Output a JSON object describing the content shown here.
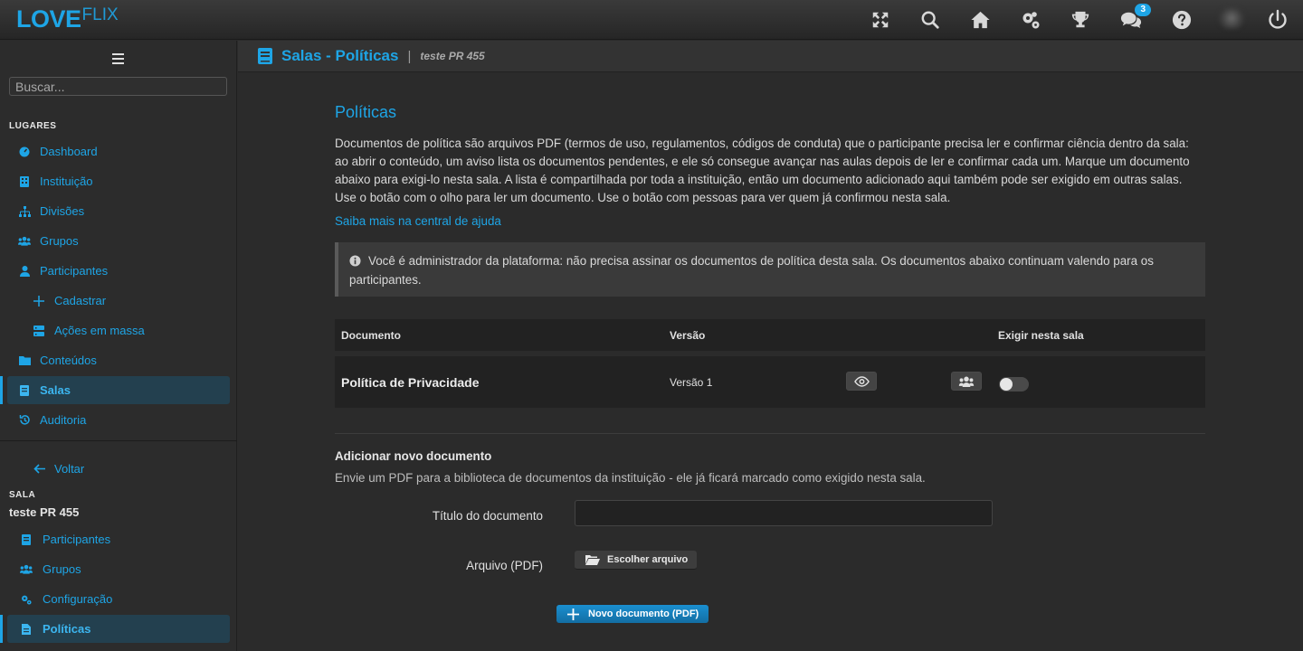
{
  "brand": {
    "love": "LOVE",
    "flix": "FLIX",
    "accent": "#1ea5e6"
  },
  "topbar": {
    "icons": [
      "fullscreen-icon",
      "search-icon",
      "home-icon",
      "settings-gears-icon",
      "trophy-icon",
      "chat-icon",
      "help-icon",
      "avatar",
      "power-icon"
    ],
    "notifications": "3"
  },
  "sidebar": {
    "search_placeholder": "Buscar...",
    "places_heading": "LUGARES",
    "items": [
      {
        "label": "Dashboard",
        "icon": "dashboard-icon"
      },
      {
        "label": "Instituição",
        "icon": "building-icon"
      },
      {
        "label": "Divisões",
        "icon": "sitemap-icon"
      },
      {
        "label": "Grupos",
        "icon": "users-icon"
      },
      {
        "label": "Participantes",
        "icon": "user-icon"
      },
      {
        "label": "Cadastrar",
        "icon": "plus-icon"
      },
      {
        "label": "Ações em massa",
        "icon": "server-icon"
      },
      {
        "label": "Conteúdos",
        "icon": "folder-icon"
      },
      {
        "label": "Salas",
        "icon": "book-icon",
        "active": true
      },
      {
        "label": "Auditoria",
        "icon": "history-icon"
      }
    ],
    "back_label": "Voltar",
    "room_heading": "SALA",
    "room_name": "teste PR 455",
    "room_items": [
      {
        "label": "Participantes",
        "icon": "book-icon"
      },
      {
        "label": "Grupos",
        "icon": "users-icon"
      },
      {
        "label": "Configuração",
        "icon": "gears-icon"
      },
      {
        "label": "Políticas",
        "icon": "file-icon",
        "active": true
      }
    ]
  },
  "header": {
    "title": "Salas - Políticas",
    "separator": "|",
    "subtitle": "teste PR 455"
  },
  "main": {
    "heading": "Políticas",
    "intro": "Documentos de política são arquivos PDF (termos de uso, regulamentos, códigos de conduta) que o participante precisa ler e confirmar ciência dentro da sala: ao abrir o conteúdo, um aviso lista os documentos pendentes, e ele só consegue avançar nas aulas depois de ler e confirmar cada um. Marque um documento abaixo para exigi-lo nesta sala. A lista é compartilhada por toda a instituição, então um documento adicionado aqui também pode ser exigido em outras salas. Use o botão com o olho para ler um documento. Use o botão com pessoas para ver quem já confirmou nesta sala.",
    "help_link": "Saiba mais na central de ajuda",
    "alert": "Você é administrador da plataforma: não precisa assinar os documentos de política desta sala. Os documentos abaixo continuam valendo para os participantes.",
    "table": {
      "columns": [
        "Documento",
        "Versão",
        "Exigir nesta sala"
      ],
      "rows": [
        {
          "document": "Política de Privacidade",
          "version": "Versão 1",
          "required": false
        }
      ]
    },
    "add": {
      "title": "Adicionar novo documento",
      "description": "Envie um PDF para a biblioteca de documentos da instituição - ele já ficará marcado como exigido nesta sala.",
      "title_label": "Título do documento",
      "title_value": "",
      "file_label": "Arquivo (PDF)",
      "file_button": "Escolher arquivo",
      "submit": "Novo documento (PDF)"
    }
  }
}
